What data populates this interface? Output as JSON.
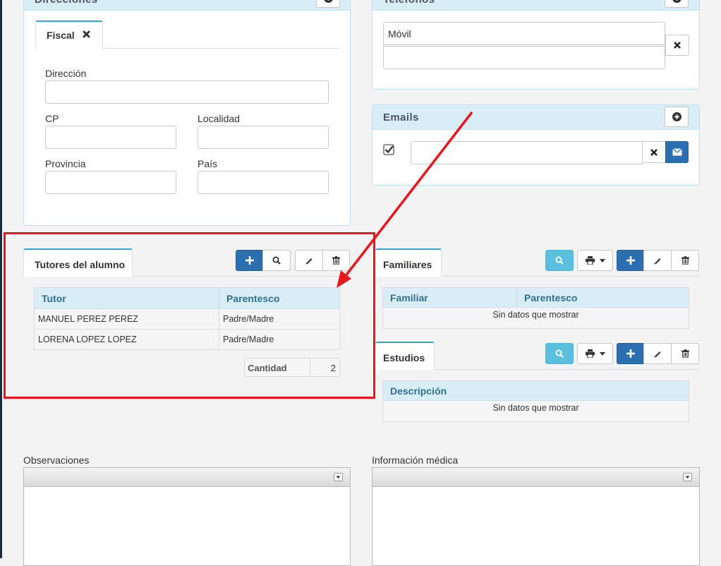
{
  "direcciones": {
    "title": "Direcciones",
    "tab_label": "Fiscal",
    "fields": {
      "direccion_label": "Dirección",
      "cp_label": "CP",
      "localidad_label": "Localidad",
      "provincia_label": "Provincia",
      "pais_label": "País"
    }
  },
  "telefonos": {
    "title": "Teléfonos",
    "type_value": "Móvil",
    "number_value": ""
  },
  "emails": {
    "title": "Emails",
    "email_value": "",
    "checked": true
  },
  "tutores": {
    "tab_label": "Tutores del alumno",
    "columns": [
      "Tutor",
      "Parentesco"
    ],
    "rows": [
      {
        "tutor": "MANUEL PEREZ PEREZ",
        "parentesco": "Padre/Madre"
      },
      {
        "tutor": "LORENA LOPEZ LOPEZ",
        "parentesco": "Padre/Madre"
      }
    ],
    "count_label": "Cantidad",
    "count_value": "2"
  },
  "familiares": {
    "tab_label": "Familiares",
    "columns": [
      "Familiar",
      "Parentesco"
    ],
    "empty_text": "Sin datos que mostrar"
  },
  "estudios": {
    "tab_label": "Estudios",
    "columns": [
      "Descripción"
    ],
    "empty_text": "Sin datos que mostrar"
  },
  "observaciones": {
    "label": "Observaciones"
  },
  "info_medica": {
    "label": "Información médica"
  },
  "colors": {
    "highlight": "#e8171c",
    "primary": "#2c6fb0",
    "info": "#5bc0de",
    "panel_head": "#d9edf7"
  }
}
